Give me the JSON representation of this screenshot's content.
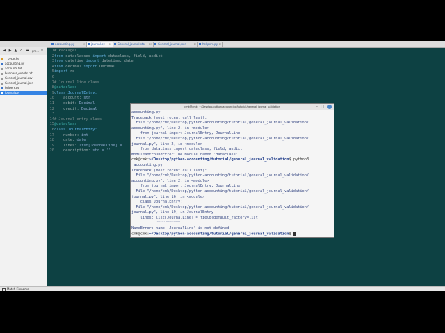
{
  "tabs": [
    {
      "label": "accounting.py"
    },
    {
      "label": "journal.py"
    },
    {
      "label": "General_journal.sto"
    },
    {
      "label": "General_journal.json"
    },
    {
      "label": "hellpers.py"
    }
  ],
  "side_toolbar": {
    "nav_label": "gre..."
  },
  "files": [
    {
      "label": "__pycache__"
    },
    {
      "label": "accounting.py"
    },
    {
      "label": "accounts.txt"
    },
    {
      "label": "business_events.txt"
    },
    {
      "label": "General_journal.csv"
    },
    {
      "label": "General_journal.json"
    },
    {
      "label": "helpers.py"
    },
    {
      "label": "journal.py"
    }
  ],
  "status": {
    "text": "Match Filename"
  },
  "editor": {
    "line_numbers": [
      "1",
      "2",
      "3",
      "4",
      "5",
      "6",
      "7",
      "8",
      "9",
      "10",
      "11",
      "12",
      "13",
      "14",
      "15",
      "16",
      "17",
      "18",
      "19",
      "20"
    ],
    "code": {
      "l1": "# Packages",
      "l2a": "from",
      "l2b": " dataclasses ",
      "l2c": "import",
      "l2d": " dataclass, field, asdict",
      "l3a": "from",
      "l3b": " datetime ",
      "l3c": "import",
      "l3d": " datetime, date",
      "l4a": "from",
      "l4b": " decimal ",
      "l4c": "import",
      "l4d": " Decimal",
      "l5a": "import",
      "l5b": " re",
      "l7": "# Journal line class",
      "l8": "@dataclass",
      "l9a": "class",
      "l9b": " JournalEntry:",
      "l10a": "    account: ",
      "l10b": "str",
      "l11a": "    debit: ",
      "l11b": "Decimal",
      "l12a": "    credit: ",
      "l12b": "Decimal",
      "l14": "# Journal entry class",
      "l15": "@dataclass",
      "l16a": "class",
      "l16b": " JournalEntry:",
      "l17a": "    number: ",
      "l17b": "int",
      "l18a": "    date: ",
      "l18b": "date",
      "l19a": "    lines: ",
      "l19b": "list[JournalLine] =",
      "l20a": "    description: ",
      "l20b": "str = ''"
    }
  },
  "terminal": {
    "title": "cmk@cmk: ~/Desktop/python-accounting/tutorial/general_journal_validation",
    "lines": [
      "accounting.py",
      "Traceback (most recent call last):",
      "  File \"/home/cmk/Desktop/python-accounting/tutorial/general_journal_validation/",
      "accounting.py\", line 2, in <module>",
      "    from journal import JournalEntry, JournalLine",
      "  File \"/home/cmk/Desktop/python-accounting/tutorial/general_journal_validation/",
      "journal.py\", line 2, in <module>",
      "    from dataclass import dataclass, field, asdict",
      "ModuleNotFoundError: No module named 'dataclass'"
    ],
    "prompt_user": "cmk@cmk:",
    "prompt_path": "~/Desktop/python-accounting/tutorial/general_journal_validation",
    "cmd1": "$ python3",
    "lines2": [
      " accounting.py",
      "Traceback (most recent call last):",
      "  File \"/home/cmk/Desktop/python-accounting/tutorial/general_journal_validation/",
      "accounting.py\", line 2, in <module>",
      "    from journal import JournalEntry, JournalLine",
      "  File \"/home/cmk/Desktop/python-accounting/tutorial/general_journal_validation/",
      "journal.py\", line 16, in <module>",
      "    class JournalEntry:",
      "  File \"/home/cmk/Desktop/python-accounting/tutorial/general_journal_validation/",
      "journal.py\", line 19, in JournalEntry",
      "    lines: list[JournalLine] = field(default_factory=list)",
      "           ^^^^^^^^^^^",
      "NameError: name 'JournalLine' is not defined"
    ],
    "cmd2": "$ "
  }
}
